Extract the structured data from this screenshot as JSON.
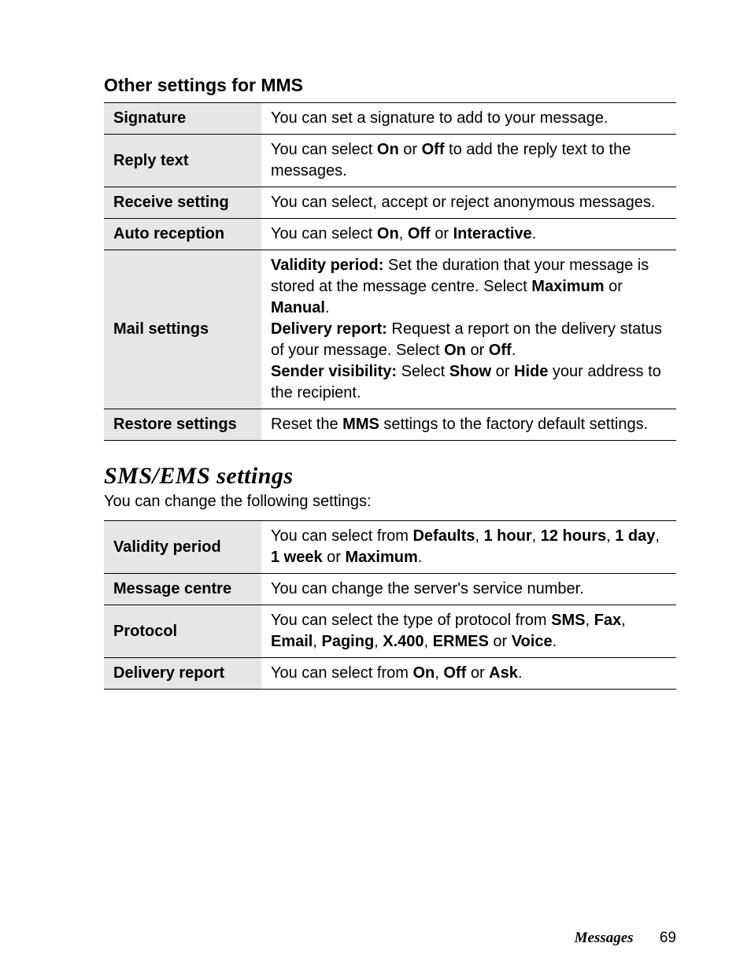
{
  "mms": {
    "heading": "Other settings for MMS",
    "rows": {
      "signature": {
        "label": "Signature",
        "desc": "You can set a signature to add to your message."
      },
      "reply_text": {
        "label": "Reply text"
      },
      "receive_setting": {
        "label": "Receive setting",
        "desc": "You can select, accept or reject anonymous messages."
      },
      "auto_reception": {
        "label": "Auto reception"
      },
      "mail_settings": {
        "label": "Mail settings"
      },
      "restore_settings": {
        "label": "Restore settings"
      }
    },
    "text": {
      "reply_pre": "You can select ",
      "on": "On",
      "or": " or ",
      "off": "Off",
      "reply_post": " to add the reply text to the messages.",
      "auto_pre": "You can select ",
      "comma": ", ",
      "interactive": "Interactive",
      "period": ".",
      "validity_label": "Validity period:",
      "validity_text": " Set the duration that your message is stored at the message centre. Select ",
      "maximum": "Maximum",
      "manual": "Manual",
      "delivery_label": "Delivery report:",
      "delivery_text": " Request a report on the delivery status of your message. Select ",
      "sender_label": "Sender visibility:",
      "sender_pre": " Select ",
      "show": "Show",
      "hide": "Hide",
      "sender_post": " your address to the recipient.",
      "restore_pre": "Reset the ",
      "mms": "MMS",
      "restore_post": " settings to the factory default settings."
    }
  },
  "sms": {
    "heading": "SMS/EMS settings",
    "intro": "You can change the following settings:",
    "rows": {
      "validity_period": {
        "label": "Validity period"
      },
      "message_centre": {
        "label": "Message centre",
        "desc": "You can change the server's service number."
      },
      "protocol": {
        "label": "Protocol"
      },
      "delivery_report": {
        "label": "Delivery report"
      }
    },
    "text": {
      "validity_pre": "You can select from ",
      "defaults": "Defaults",
      "comma": ", ",
      "one_hour": "1 hour",
      "twelve_hours": "12 hours",
      "one_day": "1 day",
      "one_week": "1 week",
      "or": " or ",
      "maximum": "Maximum",
      "period": ".",
      "protocol_pre": "You can select the type of protocol from ",
      "sms": "SMS",
      "fax": "Fax",
      "email": "Email",
      "paging": "Paging",
      "x400": "X.400",
      "ermes": "ERMES",
      "voice": "Voice",
      "delivery_pre": "You can select from ",
      "on": "On",
      "off": "Off",
      "ask": "Ask"
    }
  },
  "footer": {
    "title": "Messages",
    "page": "69"
  }
}
